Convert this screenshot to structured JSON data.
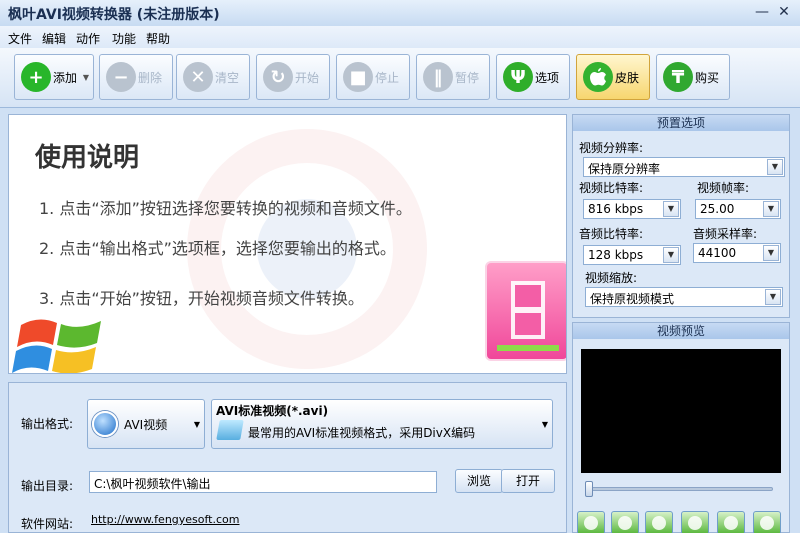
{
  "window": {
    "title": "枫叶AVI视频转换器 (未注册版本)",
    "minimize": "—",
    "close": "✕"
  },
  "menu": [
    "文件",
    "编辑",
    "动作",
    "功能",
    "帮助"
  ],
  "toolbar": [
    {
      "label": "添加",
      "icon": "plus-icon",
      "color": "#28b62a",
      "glyph": "+",
      "enabled": true,
      "dropdown": true
    },
    {
      "label": "删除",
      "icon": "minus-icon",
      "color": "#b9c3cf",
      "glyph": "−",
      "enabled": false
    },
    {
      "label": "清空",
      "icon": "clear-icon",
      "color": "#b9c3cf",
      "glyph": "✕",
      "enabled": false
    },
    {
      "label": "开始",
      "icon": "refresh-icon",
      "color": "#b9c3cf",
      "glyph": "↻",
      "enabled": false
    },
    {
      "label": "停止",
      "icon": "stop-icon",
      "color": "#b9c3cf",
      "glyph": "■",
      "enabled": false
    },
    {
      "label": "暂停",
      "icon": "pause-icon",
      "color": "#b9c3cf",
      "glyph": "‖",
      "enabled": false
    },
    {
      "label": "选项",
      "icon": "options-icon",
      "color": "#2fae2a",
      "glyph": "Ψ",
      "enabled": true
    },
    {
      "label": "皮肤",
      "icon": "apple-icon",
      "color": "#34b230",
      "glyph": "",
      "enabled": true,
      "active": true
    },
    {
      "label": "购买",
      "icon": "cart-icon",
      "color": "#30a830",
      "glyph": "₸",
      "enabled": true
    }
  ],
  "guide": {
    "title": "使用说明",
    "steps": [
      "1. 点击“添加”按钮选择您要转换的视频和音频文件。",
      "2. 点击“输出格式”选项框，选择您要输出的格式。",
      "3. 点击“开始”按钮，开始视频音频文件转换。"
    ]
  },
  "output": {
    "format_label": "输出格式:",
    "format_name": "AVI视频",
    "format_title": "AVI标准视频(*.avi)",
    "format_desc": "最常用的AVI标准视频格式，采用DivX编码",
    "dir_label": "输出目录:",
    "dir_value": "C:\\枫叶视频软件\\输出",
    "browse": "浏览",
    "open": "打开",
    "site_label": "软件网站:",
    "site_url": "http://www.fengyesoft.com"
  },
  "presets": {
    "header": "预置选项",
    "resolution_label": "视频分辨率:",
    "resolution_value": "保持原分辨率",
    "vbitrate_label": "视频比特率:",
    "vbitrate_value": "816 kbps",
    "framerate_label": "视频帧率:",
    "framerate_value": "25.00",
    "abitrate_label": "音频比特率:",
    "abitrate_value": "128 kbps",
    "samplerate_label": "音频采样率:",
    "samplerate_value": "44100",
    "scale_label": "视频缩放:",
    "scale_value": "保持原视频模式"
  },
  "preview": {
    "header": "视频预览",
    "seek": 0
  }
}
